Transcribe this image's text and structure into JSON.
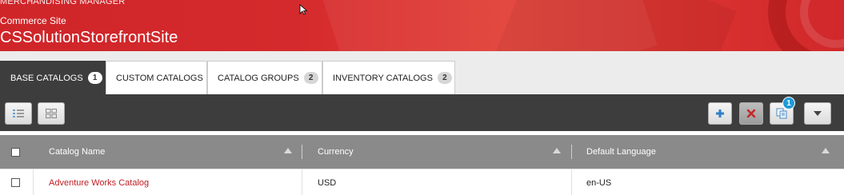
{
  "header": {
    "app_title": "MERCHANDISING MANAGER",
    "site_label": "Commerce Site",
    "site_name": "CSSolutionStorefrontSite"
  },
  "tabs": [
    {
      "label": "BASE CATALOGS",
      "count": "1",
      "active": true
    },
    {
      "label": "CUSTOM CATALOGS",
      "count": null,
      "active": false
    },
    {
      "label": "CATALOG GROUPS",
      "count": "2",
      "active": false
    },
    {
      "label": "INVENTORY CATALOGS",
      "count": "2",
      "active": false
    }
  ],
  "toolbar": {
    "left_buttons": [
      "list-view-icon",
      "grid-view-icon"
    ],
    "right_buttons": [
      "add-icon",
      "delete-icon",
      "copy-icon",
      "dropdown-icon"
    ],
    "notification_count": "1"
  },
  "grid": {
    "columns": [
      "Catalog Name",
      "Currency",
      "Default Language"
    ],
    "rows": [
      {
        "name": "Adventure Works Catalog",
        "currency": "USD",
        "language": "en-US"
      }
    ]
  },
  "colors": {
    "brand_red": "#d52a2d",
    "toolbar_dark": "#3d3d3d",
    "header_gray": "#8a8a8a",
    "link_red": "#c01d22",
    "badge_blue": "#1e9bd7"
  }
}
